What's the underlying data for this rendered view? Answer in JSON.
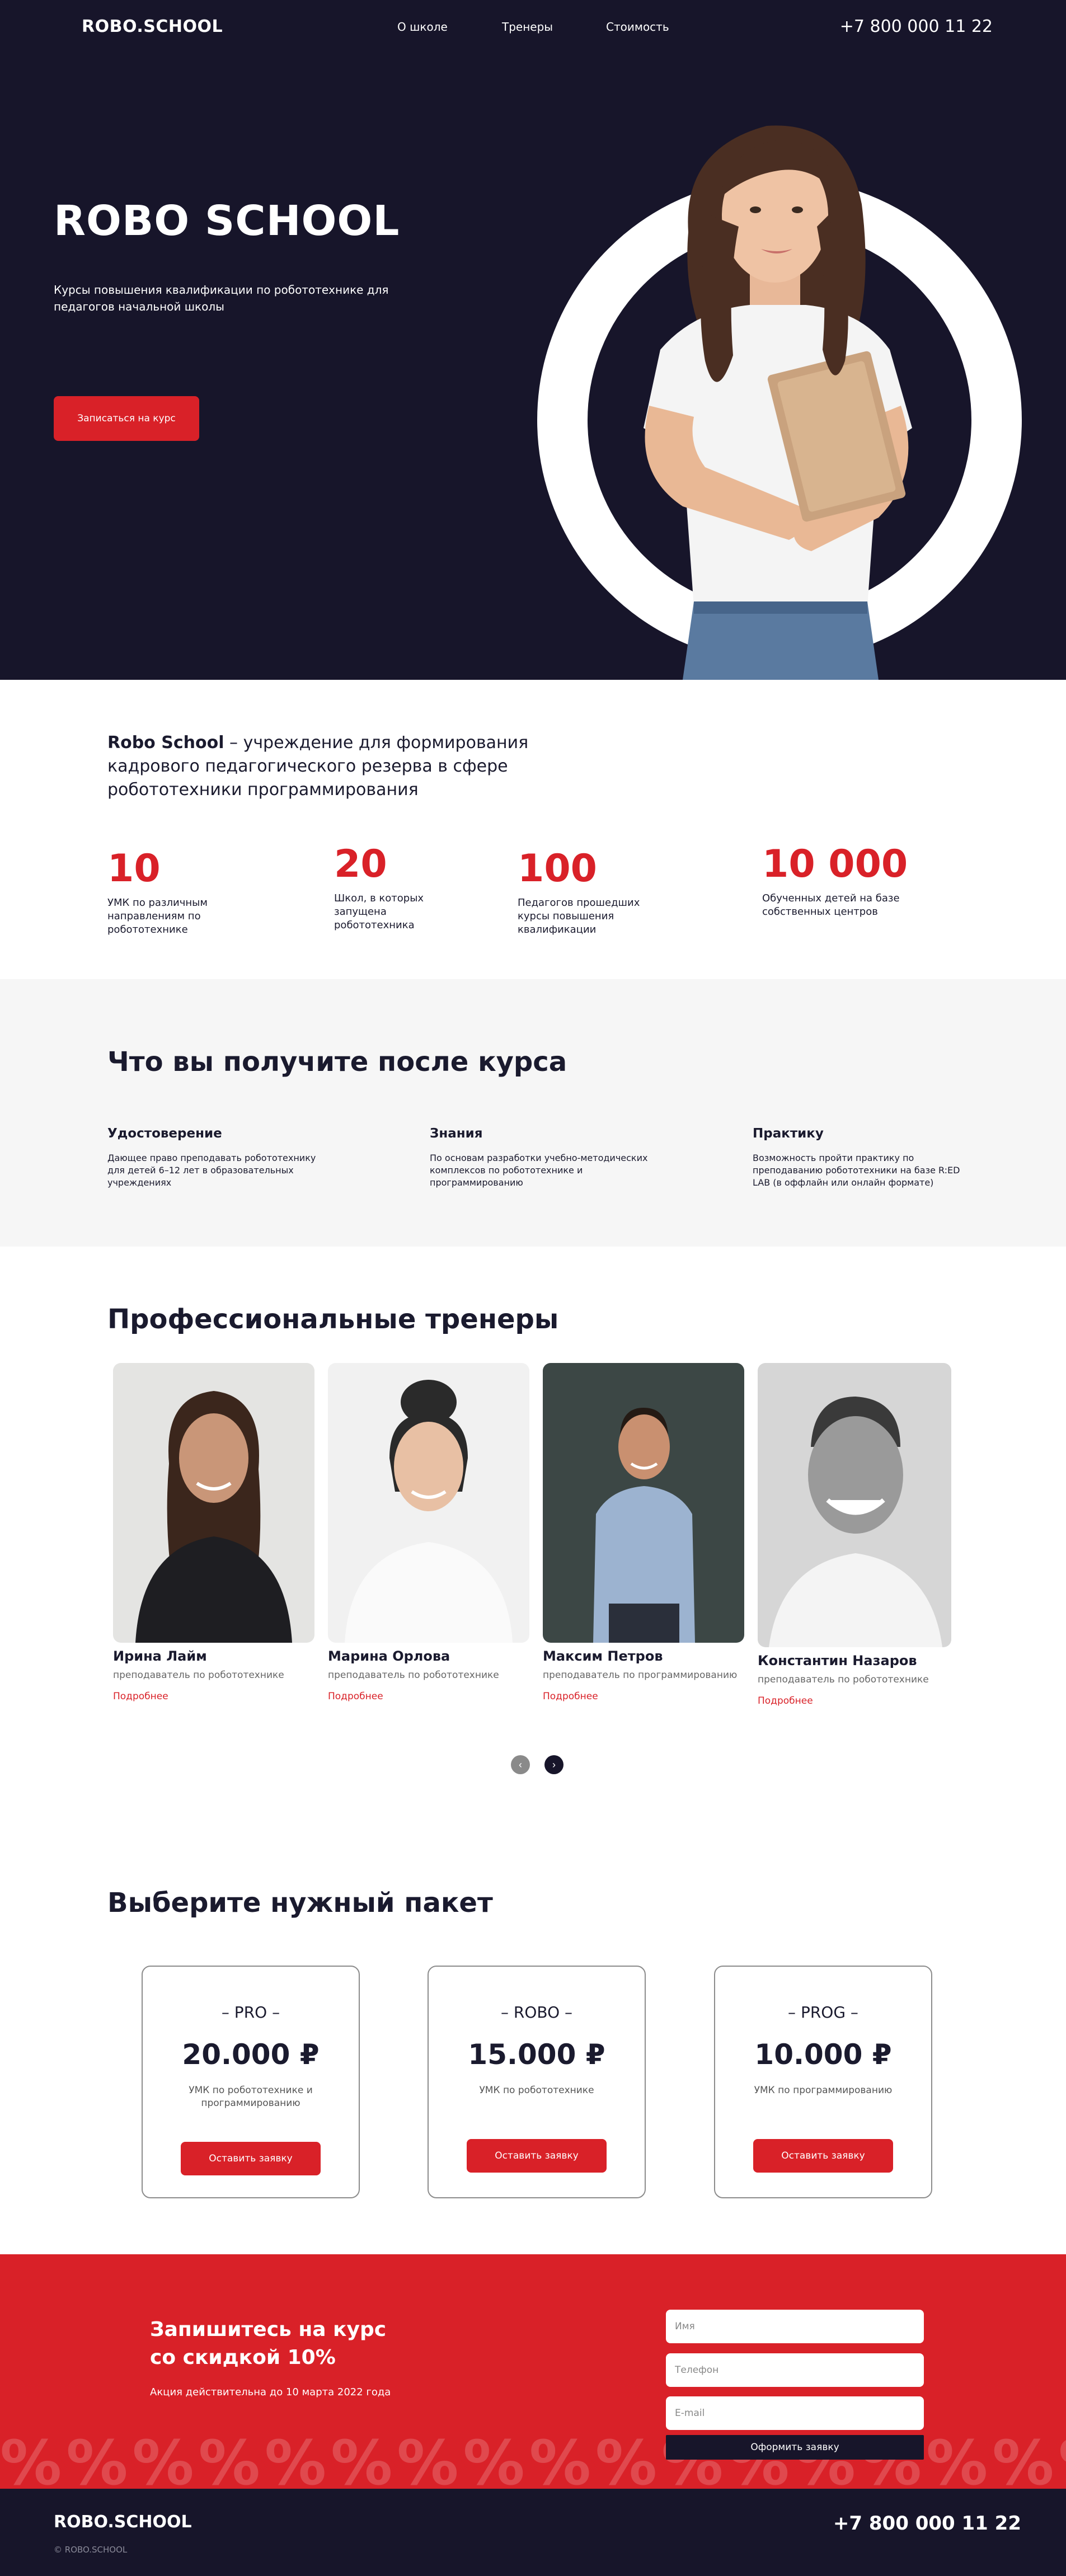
{
  "nav": {
    "logo": "ROBO.SCHOOL",
    "links": [
      "О школе",
      "Тренеры",
      "Стоимость"
    ],
    "phone": "+7 800 000 11 22"
  },
  "hero": {
    "title": "ROBO SCHOOL",
    "subtitle": "Курсы повышения квалификации по робототехнике для педагогов начальной школы",
    "cta": "Записаться на курс"
  },
  "about": {
    "lead_bold": "Robo School",
    "lead_rest": " – учреждение для формирования кадрового педагогического резерва в сфере робототехники программирования",
    "stats": [
      {
        "number": "10",
        "label": "УМК по различным направлениям по робототехнике"
      },
      {
        "number": "20",
        "label": "Школ, в которых запущена робототехника"
      },
      {
        "number": "100",
        "label": "Педагогов прошедших курсы повышения квалификации"
      },
      {
        "number": "10 000",
        "label": "Обученных детей на базе собственных центров"
      }
    ]
  },
  "benefits": {
    "title": "Что вы получите после курса",
    "items": [
      {
        "title": "Удостоверение",
        "text": "Дающее право преподавать робототехнику для детей 6–12 лет в образовательных учреждениях"
      },
      {
        "title": "Знания",
        "text": "По основам разработки учебно-методических комплексов по робототехнике и программированию"
      },
      {
        "title": "Практику",
        "text": "Возможность пройти практику по преподаванию робототехники на базе R:ED LAB (в оффлайн или онлайн формате)"
      }
    ]
  },
  "trainers": {
    "title": "Профессиональные тренеры",
    "more_label": "Подробнее",
    "items": [
      {
        "name": "Ирина Лайм",
        "role": "преподаватель по робототехнике"
      },
      {
        "name": "Марина Орлова",
        "role": "преподаватель по робототехнике"
      },
      {
        "name": "Максим Петров",
        "role": "преподаватель по программированию"
      },
      {
        "name": "Константин Назаров",
        "role": "преподаватель по робототехнике"
      }
    ],
    "slider": {
      "prev": "‹",
      "next": "›"
    }
  },
  "packages": {
    "title": "Выберите нужный пакет",
    "button_label": "Оставить заявку",
    "items": [
      {
        "name": "– PRO –",
        "price": "20.000 ₽",
        "desc": "УМК по робототехнике и программированию"
      },
      {
        "name": "– ROBO –",
        "price": "15.000 ₽",
        "desc": "УМК по робототехнике"
      },
      {
        "name": "– PROG –",
        "price": "10.000 ₽",
        "desc": "УМК по программированию"
      }
    ]
  },
  "promo": {
    "title": "Запишитесь на курс со скидкой 10%",
    "note": "Акция действительна до 10 марта 2022 года",
    "fields": {
      "name": "Имя",
      "phone": "Телефон",
      "email": "E-mail"
    },
    "submit": "Оформить заявку",
    "pattern": "%%%%%%%%%%%%%%%%%%%%"
  },
  "footer": {
    "logo": "ROBO.SCHOOL",
    "copyright": "© ROBO.SCHOOL",
    "phone": "+7 800 000 11 22"
  },
  "colors": {
    "accent": "#d92128",
    "dark": "#17152a",
    "light_bg": "#f6f6f6"
  }
}
